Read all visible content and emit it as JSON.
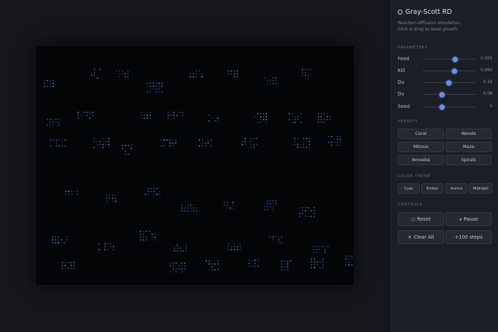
{
  "app": {
    "title": "Gray-Scott RD",
    "description_lines": [
      "Reaction-diffusion simulation.",
      "Click & drag to seed growth."
    ]
  },
  "sections": {
    "parameters": "PARAMETERS",
    "presets": "PRESETS",
    "color_theme": "COLOR THEME",
    "controls": "CONTROLS"
  },
  "parameters": [
    {
      "label": "Feed",
      "value": "0.055",
      "fraction": 0.62
    },
    {
      "label": "Kill",
      "value": "0.062",
      "fraction": 0.61
    },
    {
      "label": "Du",
      "value": "0.16",
      "fraction": 0.5
    },
    {
      "label": "Dv",
      "value": "0.08",
      "fraction": 0.37
    },
    {
      "label": "Seed",
      "value": "5",
      "fraction": 0.37
    }
  ],
  "presets": [
    "Coral",
    "Woods",
    "Mitosis",
    "Maze",
    "Amoeba",
    "Spirals"
  ],
  "color_themes": [
    "Cyan",
    "Ember",
    "Aurora",
    "Midnight"
  ],
  "controls": {
    "reset": "Reset",
    "pause": "Pause",
    "clear_all": "Clear All",
    "step": "+100 steps"
  },
  "icons": {
    "title": "circle-icon",
    "reset": "reset-icon",
    "pause": "pause-icon",
    "clear": "x-icon"
  },
  "colors": {
    "accent": "#6b8fe6",
    "spot_core": "#5cc8e8",
    "spot_edge": "#3a6fd0",
    "spot_pink": "#c07ad8"
  }
}
